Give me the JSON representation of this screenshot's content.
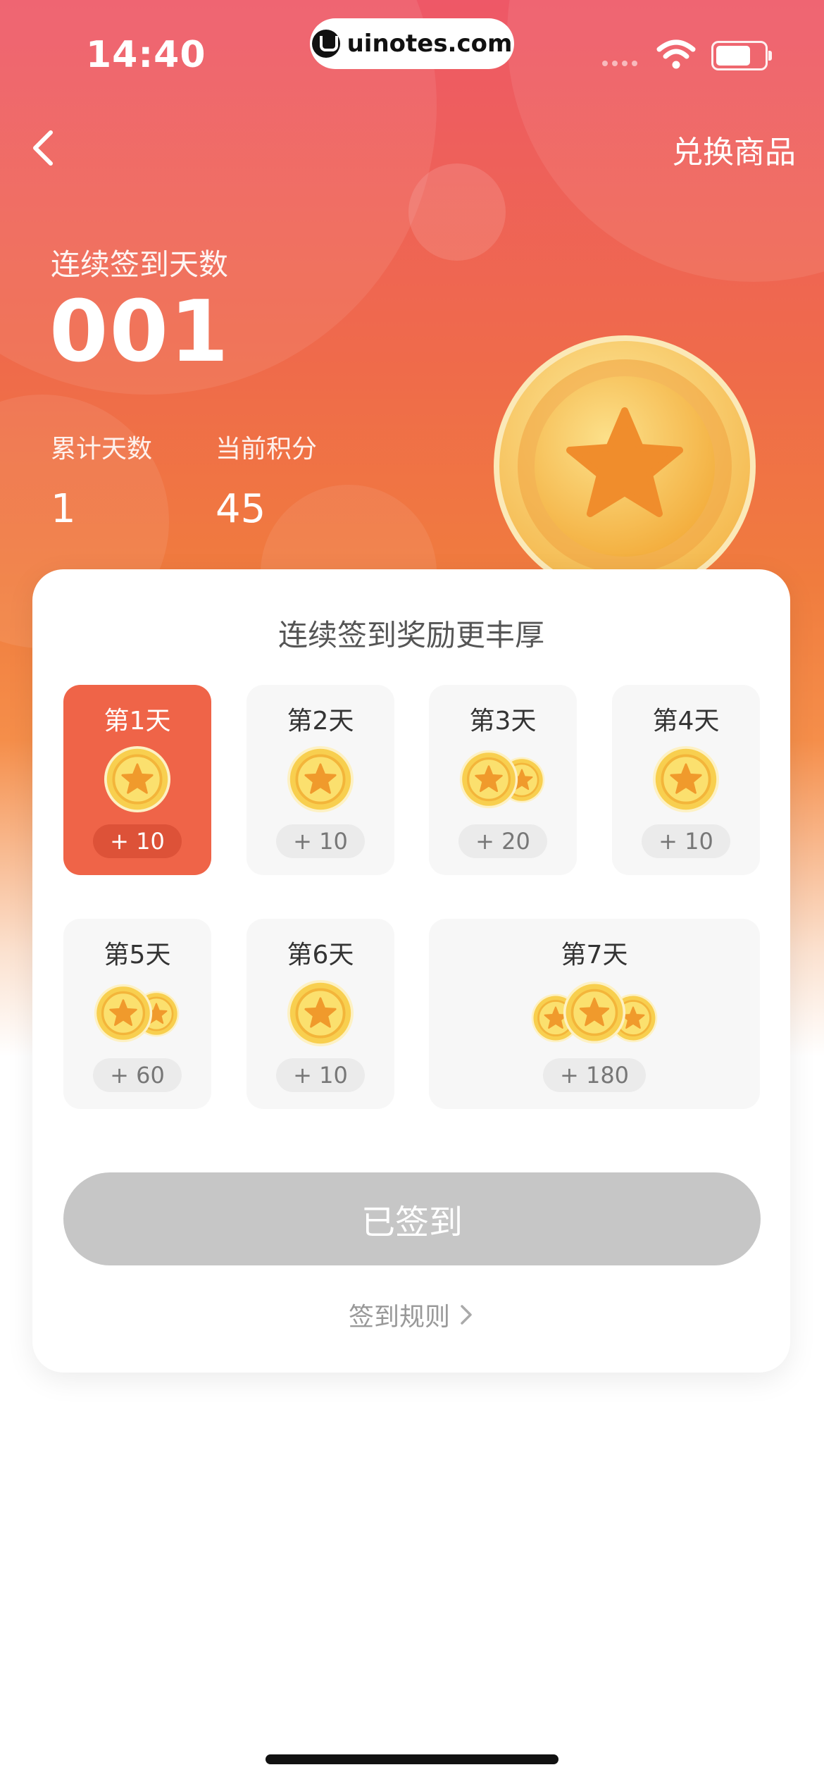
{
  "status_bar": {
    "time": "14:40",
    "url": "uinotes.com"
  },
  "nav": {
    "back_icon": "chevron-left-icon",
    "exchange_label": "兑换商品"
  },
  "summary": {
    "streak_label": "连续签到天数",
    "streak_value": "001",
    "total_days_label": "累计天数",
    "total_days_value": "1",
    "points_label": "当前积分",
    "points_value": "45"
  },
  "card": {
    "title": "连续签到奖励更丰厚",
    "days": [
      {
        "label": "第1天",
        "reward": "+ 10",
        "coins": 1,
        "active": true
      },
      {
        "label": "第2天",
        "reward": "+ 10",
        "coins": 1,
        "active": false
      },
      {
        "label": "第3天",
        "reward": "+ 20",
        "coins": 2,
        "active": false
      },
      {
        "label": "第4天",
        "reward": "+ 10",
        "coins": 1,
        "active": false
      },
      {
        "label": "第5天",
        "reward": "+ 60",
        "coins": 2,
        "active": false
      },
      {
        "label": "第6天",
        "reward": "+ 10",
        "coins": 1,
        "active": false
      },
      {
        "label": "第7天",
        "reward": "+ 180",
        "coins": 3,
        "active": false
      }
    ],
    "signed_button": "已签到",
    "rules_link": "签到规则"
  },
  "colors": {
    "accent": "#ef6448",
    "coin_gold": "#f5c240",
    "button_disabled": "#c6c6c6"
  }
}
